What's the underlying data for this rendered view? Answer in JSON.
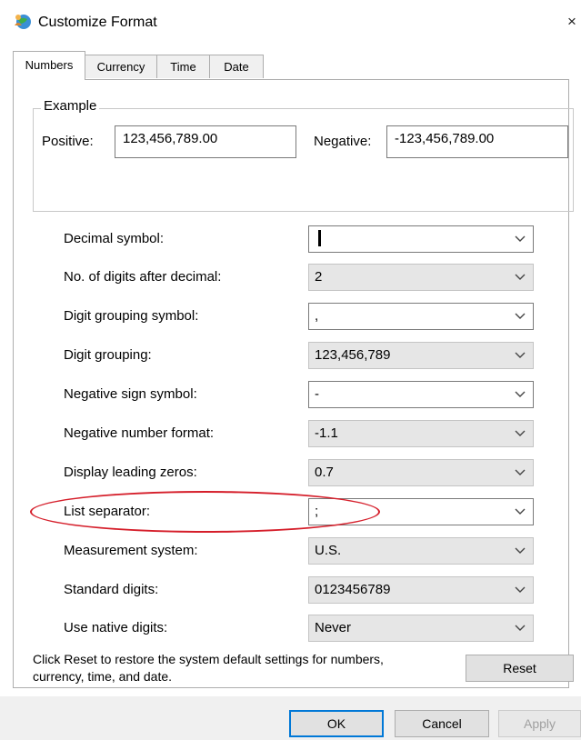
{
  "window": {
    "title": "Customize Format",
    "close_glyph": "×",
    "icon": "globe-person-icon"
  },
  "tabs": [
    {
      "label": "Numbers",
      "active": true
    },
    {
      "label": "Currency",
      "active": false
    },
    {
      "label": "Time",
      "active": false
    },
    {
      "label": "Date",
      "active": false
    }
  ],
  "example": {
    "group_title": "Example",
    "positive_label": "Positive:",
    "positive_value": "123,456,789.00",
    "negative_label": "Negative:",
    "negative_value": "-123,456,789.00"
  },
  "settings": [
    {
      "label": "Decimal symbol:",
      "value": "",
      "editable": true,
      "caret": true
    },
    {
      "label": "No. of digits after decimal:",
      "value": "2",
      "editable": false
    },
    {
      "label": "Digit grouping symbol:",
      "value": ",",
      "editable": true
    },
    {
      "label": "Digit grouping:",
      "value": "123,456,789",
      "editable": false
    },
    {
      "label": "Negative sign symbol:",
      "value": "-",
      "editable": true
    },
    {
      "label": "Negative number format:",
      "value": "-1.1",
      "editable": false
    },
    {
      "label": "Display leading zeros:",
      "value": "0.7",
      "editable": false
    },
    {
      "label": "List separator:",
      "value": ";",
      "editable": true,
      "highlighted": true
    },
    {
      "label": "Measurement system:",
      "value": "U.S.",
      "editable": false
    },
    {
      "label": "Standard digits:",
      "value": "0123456789",
      "editable": false
    },
    {
      "label": "Use native digits:",
      "value": "Never",
      "editable": false
    }
  ],
  "reset_note": "Click Reset to restore the system default settings for numbers, currency, time, and date.",
  "buttons": {
    "reset": "Reset",
    "ok": "OK",
    "cancel": "Cancel",
    "apply": "Apply"
  },
  "colors": {
    "highlight_oval": "#d51e2a",
    "default_button_border": "#0078d7"
  }
}
